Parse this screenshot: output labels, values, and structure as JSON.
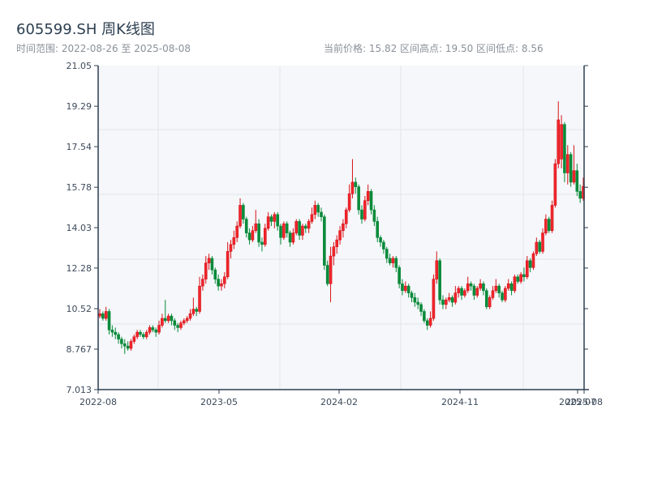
{
  "header": {
    "title": "605599.SH 周K线图",
    "range_text": "时间范围: 2022-08-26 至 2025-08-08",
    "stats_text": "当前价格: 15.82  区间高点: 19.50  区间低点: 8.56"
  },
  "colors": {
    "up": "#d7141a",
    "down": "#0a8a3a",
    "plot_bg": "#f5f7fa",
    "grid": "#e1e4ea",
    "axis": "#2c3e50"
  },
  "chart_data": {
    "type": "candlestick",
    "title": "605599.SH 周K线图",
    "ylim": [
      7.013,
      21.05
    ],
    "y_ticks": [
      "7.013",
      "8.767",
      "10.52",
      "12.28",
      "14.03",
      "15.78",
      "17.54",
      "19.29",
      "21.05"
    ],
    "x_ticks": [
      "2022-08",
      "2023-05",
      "2024-02",
      "2024-11",
      "2025-07",
      "2025-08"
    ],
    "start": "2022-08-26",
    "end": "2025-08-08",
    "grid": true,
    "ohlc": [
      [
        10.2,
        10.5,
        10.1,
        10.3
      ],
      [
        10.3,
        10.4,
        10.0,
        10.1
      ],
      [
        10.1,
        10.6,
        10.0,
        10.4
      ],
      [
        10.4,
        10.5,
        9.4,
        9.6
      ],
      [
        9.6,
        9.8,
        9.3,
        9.5
      ],
      [
        9.5,
        9.7,
        9.2,
        9.4
      ],
      [
        9.4,
        9.5,
        9.0,
        9.2
      ],
      [
        9.2,
        9.3,
        8.8,
        9.0
      ],
      [
        9.0,
        9.2,
        8.56,
        8.9
      ],
      [
        8.9,
        9.1,
        8.7,
        8.8
      ],
      [
        8.8,
        9.2,
        8.7,
        9.1
      ],
      [
        9.1,
        9.4,
        9.0,
        9.3
      ],
      [
        9.3,
        9.6,
        9.2,
        9.5
      ],
      [
        9.5,
        9.6,
        9.3,
        9.4
      ],
      [
        9.4,
        9.5,
        9.2,
        9.3
      ],
      [
        9.3,
        9.6,
        9.2,
        9.5
      ],
      [
        9.5,
        9.8,
        9.4,
        9.7
      ],
      [
        9.7,
        9.8,
        9.5,
        9.6
      ],
      [
        9.6,
        9.7,
        9.3,
        9.5
      ],
      [
        9.5,
        10.0,
        9.4,
        9.8
      ],
      [
        9.8,
        10.3,
        9.7,
        10.1
      ],
      [
        10.1,
        10.9,
        9.9,
        10.0
      ],
      [
        10.0,
        10.3,
        9.9,
        10.2
      ],
      [
        10.2,
        10.3,
        9.8,
        10.0
      ],
      [
        10.0,
        10.1,
        9.6,
        9.8
      ],
      [
        9.8,
        9.9,
        9.5,
        9.7
      ],
      [
        9.7,
        10.0,
        9.6,
        9.9
      ],
      [
        9.9,
        10.1,
        9.8,
        10.0
      ],
      [
        10.0,
        10.2,
        9.9,
        10.1
      ],
      [
        10.1,
        10.5,
        10.0,
        10.3
      ],
      [
        10.3,
        11.0,
        10.2,
        10.5
      ],
      [
        10.5,
        10.6,
        10.2,
        10.4
      ],
      [
        10.4,
        11.9,
        10.3,
        11.5
      ],
      [
        11.5,
        12.0,
        11.3,
        11.8
      ],
      [
        11.8,
        12.8,
        11.6,
        12.5
      ],
      [
        12.5,
        12.9,
        12.2,
        12.7
      ],
      [
        12.7,
        12.8,
        12.0,
        12.2
      ],
      [
        12.2,
        12.3,
        11.6,
        11.8
      ],
      [
        11.8,
        12.0,
        11.3,
        11.5
      ],
      [
        11.5,
        11.8,
        11.3,
        11.6
      ],
      [
        11.6,
        12.1,
        11.4,
        11.9
      ],
      [
        11.9,
        13.4,
        11.8,
        13.0
      ],
      [
        13.0,
        13.5,
        12.7,
        13.3
      ],
      [
        13.3,
        13.9,
        13.1,
        13.6
      ],
      [
        13.6,
        14.3,
        13.4,
        14.1
      ],
      [
        14.1,
        15.3,
        14.0,
        15.0
      ],
      [
        15.0,
        15.1,
        14.2,
        14.4
      ],
      [
        14.4,
        14.5,
        13.6,
        13.8
      ],
      [
        13.8,
        14.0,
        13.3,
        13.5
      ],
      [
        13.5,
        14.1,
        13.4,
        13.9
      ],
      [
        13.9,
        14.8,
        13.8,
        14.2
      ],
      [
        14.2,
        14.4,
        13.2,
        13.4
      ],
      [
        13.4,
        13.6,
        13.0,
        13.3
      ],
      [
        13.3,
        14.2,
        13.2,
        14.0
      ],
      [
        14.0,
        14.7,
        13.9,
        14.5
      ],
      [
        14.5,
        14.6,
        14.1,
        14.3
      ],
      [
        14.3,
        14.7,
        14.0,
        14.6
      ],
      [
        14.6,
        14.7,
        13.9,
        14.1
      ],
      [
        14.1,
        14.2,
        13.3,
        13.6
      ],
      [
        13.6,
        14.3,
        13.5,
        14.2
      ],
      [
        14.2,
        14.3,
        13.6,
        13.8
      ],
      [
        13.8,
        13.9,
        13.2,
        13.4
      ],
      [
        13.4,
        14.0,
        13.3,
        13.8
      ],
      [
        13.8,
        14.4,
        13.7,
        14.3
      ],
      [
        14.3,
        14.4,
        13.5,
        13.7
      ],
      [
        13.7,
        14.2,
        13.5,
        14.1
      ],
      [
        14.1,
        14.2,
        13.8,
        14.0
      ],
      [
        14.0,
        14.4,
        13.8,
        14.3
      ],
      [
        14.3,
        14.9,
        14.2,
        14.6
      ],
      [
        14.6,
        15.2,
        14.4,
        15.0
      ],
      [
        15.0,
        15.1,
        14.5,
        14.7
      ],
      [
        14.7,
        14.9,
        14.3,
        14.5
      ],
      [
        14.5,
        14.6,
        12.2,
        12.4
      ],
      [
        12.4,
        12.6,
        11.5,
        11.6
      ],
      [
        11.6,
        13.2,
        10.8,
        12.8
      ],
      [
        12.8,
        13.4,
        12.4,
        13.2
      ],
      [
        13.2,
        13.7,
        12.9,
        13.5
      ],
      [
        13.5,
        14.1,
        13.3,
        13.9
      ],
      [
        13.9,
        14.4,
        13.6,
        14.2
      ],
      [
        14.2,
        14.9,
        14.0,
        14.8
      ],
      [
        14.8,
        15.9,
        14.7,
        15.5
      ],
      [
        15.5,
        17.0,
        15.3,
        16.0
      ],
      [
        16.0,
        16.2,
        15.5,
        15.8
      ],
      [
        15.8,
        15.9,
        14.6,
        14.8
      ],
      [
        14.8,
        15.0,
        14.2,
        14.4
      ],
      [
        14.4,
        15.4,
        14.3,
        15.2
      ],
      [
        15.2,
        15.9,
        15.0,
        15.6
      ],
      [
        15.6,
        15.7,
        14.6,
        14.8
      ],
      [
        14.8,
        15.0,
        14.1,
        14.3
      ],
      [
        14.3,
        14.5,
        13.4,
        13.6
      ],
      [
        13.6,
        13.7,
        13.2,
        13.4
      ],
      [
        13.4,
        13.5,
        12.9,
        13.1
      ],
      [
        13.1,
        13.2,
        12.5,
        12.7
      ],
      [
        12.7,
        12.9,
        12.4,
        12.5
      ],
      [
        12.5,
        12.8,
        12.3,
        12.7
      ],
      [
        12.7,
        12.8,
        12.1,
        12.3
      ],
      [
        12.3,
        12.4,
        11.4,
        11.6
      ],
      [
        11.6,
        11.8,
        11.1,
        11.3
      ],
      [
        11.3,
        11.7,
        11.2,
        11.5
      ],
      [
        11.5,
        11.6,
        11.0,
        11.2
      ],
      [
        11.2,
        11.3,
        10.8,
        11.0
      ],
      [
        11.0,
        11.2,
        10.6,
        10.8
      ],
      [
        10.8,
        11.0,
        10.5,
        10.7
      ],
      [
        10.7,
        10.8,
        10.2,
        10.4
      ],
      [
        10.4,
        10.5,
        9.9,
        10.0
      ],
      [
        10.0,
        10.1,
        9.6,
        9.8
      ],
      [
        9.8,
        10.4,
        9.7,
        10.1
      ],
      [
        10.1,
        12.0,
        10.0,
        11.8
      ],
      [
        11.8,
        13.0,
        11.6,
        12.6
      ],
      [
        12.6,
        12.7,
        10.7,
        10.9
      ],
      [
        10.9,
        11.1,
        10.5,
        10.7
      ],
      [
        10.7,
        11.0,
        10.5,
        10.9
      ],
      [
        10.9,
        11.2,
        10.8,
        11.0
      ],
      [
        11.0,
        11.1,
        10.6,
        10.8
      ],
      [
        10.8,
        11.5,
        10.7,
        11.2
      ],
      [
        11.2,
        11.5,
        11.0,
        11.4
      ],
      [
        11.4,
        11.5,
        10.9,
        11.1
      ],
      [
        11.1,
        11.4,
        11.0,
        11.3
      ],
      [
        11.3,
        11.9,
        11.2,
        11.6
      ],
      [
        11.6,
        11.7,
        11.3,
        11.5
      ],
      [
        11.5,
        11.6,
        10.9,
        11.1
      ],
      [
        11.1,
        11.5,
        11.0,
        11.4
      ],
      [
        11.4,
        11.8,
        11.3,
        11.6
      ],
      [
        11.6,
        11.7,
        11.1,
        11.3
      ],
      [
        11.3,
        11.4,
        10.5,
        10.6
      ],
      [
        10.6,
        11.1,
        10.5,
        11.0
      ],
      [
        11.0,
        11.5,
        10.9,
        11.3
      ],
      [
        11.3,
        11.8,
        11.2,
        11.5
      ],
      [
        11.5,
        11.6,
        11.0,
        11.2
      ],
      [
        11.2,
        11.3,
        10.8,
        10.9
      ],
      [
        10.9,
        11.5,
        10.8,
        11.4
      ],
      [
        11.4,
        11.8,
        11.3,
        11.6
      ],
      [
        11.6,
        11.7,
        11.1,
        11.3
      ],
      [
        11.3,
        12.0,
        11.2,
        11.9
      ],
      [
        11.9,
        12.0,
        11.6,
        11.7
      ],
      [
        11.7,
        12.1,
        11.6,
        12.0
      ],
      [
        12.0,
        12.3,
        11.7,
        11.9
      ],
      [
        11.9,
        12.8,
        11.8,
        12.6
      ],
      [
        12.6,
        12.7,
        12.1,
        12.3
      ],
      [
        12.3,
        13.0,
        12.2,
        12.9
      ],
      [
        12.9,
        13.6,
        12.8,
        13.4
      ],
      [
        13.4,
        13.5,
        12.9,
        13.0
      ],
      [
        13.0,
        14.0,
        12.9,
        13.8
      ],
      [
        13.8,
        14.6,
        13.7,
        14.4
      ],
      [
        14.4,
        14.5,
        13.8,
        13.9
      ],
      [
        13.9,
        15.2,
        13.8,
        15.0
      ],
      [
        15.0,
        17.0,
        14.9,
        16.8
      ],
      [
        16.8,
        19.5,
        16.6,
        18.7
      ],
      [
        17.0,
        18.9,
        16.6,
        18.5
      ],
      [
        18.5,
        18.6,
        16.0,
        16.4
      ],
      [
        16.4,
        17.6,
        15.9,
        17.2
      ],
      [
        17.2,
        17.3,
        15.8,
        16.0
      ],
      [
        16.0,
        17.6,
        15.9,
        16.5
      ],
      [
        16.5,
        16.8,
        15.4,
        15.6
      ],
      [
        15.6,
        15.9,
        15.1,
        15.3
      ],
      [
        15.3,
        16.2,
        15.2,
        15.82
      ]
    ]
  }
}
